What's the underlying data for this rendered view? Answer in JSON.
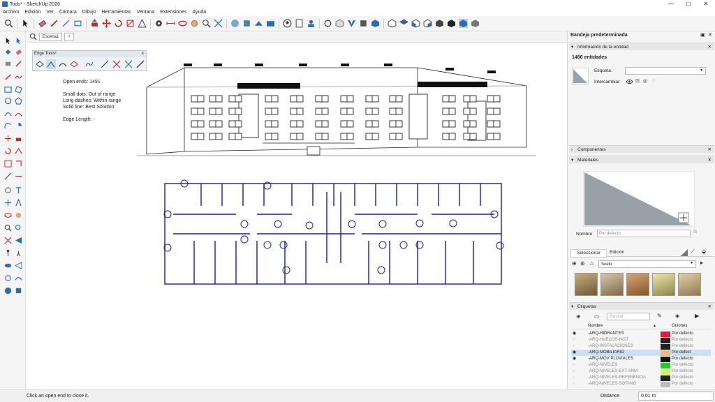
{
  "window": {
    "title": "Todo* - SketchUp 2026",
    "min": "—",
    "max": "▢",
    "close": "✕"
  },
  "menu": [
    "Archivo",
    "Edición",
    "Ver",
    "Cámara",
    "Dibujo",
    "Herramientas",
    "Ventana",
    "Extensiones",
    "Ayuda"
  ],
  "scene": {
    "tab": "Escena1",
    "add": "+"
  },
  "edge_tools": {
    "title": "Edge Tools²",
    "close": "x"
  },
  "overlay": {
    "open_ends": "Open ends: 1491",
    "line1": "Small dots: Out of range",
    "line2": "Long dashes: Within range",
    "line3": "Solid line: Best Solution",
    "edge_length": "Edge Length: -"
  },
  "status": {
    "hint": "Click an open end to close it.",
    "distance_label": "Distance",
    "distance_value": "0,01 m"
  },
  "tray": {
    "title": "Bandeja predeterminada"
  },
  "entity": {
    "section": "Información de la entidad",
    "count": "1486 entidades",
    "etiqueta_label": "Etiqueta:",
    "intercambiar_label": "Intercambiar:"
  },
  "components": {
    "section": "Componentes"
  },
  "materials": {
    "section": "Materiales",
    "nombre_label": "Nombre",
    "nombre_value": "Por defecto",
    "tab_select": "Seleccionar",
    "tab_edit": "Edición",
    "library": "Suelo"
  },
  "tags": {
    "section": "Etiquetas",
    "search_placeholder": "Buscar",
    "col_name": "Nombre",
    "col_dash": "Guiones",
    "rows": [
      {
        "name": "-ARQ-HIDRANTES",
        "dash": "Por defecto",
        "color": "#e8163a",
        "visible": true,
        "ghost": false,
        "selected": false
      },
      {
        "name": "-ARQ-HUECOS-INST",
        "dash": "Por defecto",
        "color": "#222222",
        "visible": false,
        "ghost": true,
        "selected": false
      },
      {
        "name": "-ARQ-INSTALACIONES",
        "dash": "Por defecto",
        "color": "#222222",
        "visible": false,
        "ghost": true,
        "selected": false
      },
      {
        "name": "-ARQ-MOBILIARIO",
        "dash": "Por defect",
        "color": "#f0b982",
        "visible": true,
        "ghost": false,
        "selected": true
      },
      {
        "name": "-ARQ-MOV PLUVIALES",
        "dash": "Por defecto",
        "color": "#111111",
        "visible": true,
        "ghost": false,
        "selected": false
      },
      {
        "name": "-ARQ-NIVELES",
        "dash": "Por defecto",
        "color": "#22cc22",
        "visible": false,
        "ghost": true,
        "selected": false
      },
      {
        "name": "-ARQ-NIVELES-EXT-SNM",
        "dash": "Por defecto",
        "color": "#d8f070",
        "visible": false,
        "ghost": true,
        "selected": false
      },
      {
        "name": "-ARQ-NIVELES-REFERENCIA",
        "dash": "Por defecto",
        "color": "#222222",
        "visible": false,
        "ghost": true,
        "selected": false
      },
      {
        "name": "-ARQ-NIVELES-SOTANO",
        "dash": "Por defecto",
        "color": "#bbbbbb",
        "visible": false,
        "ghost": true,
        "selected": false
      }
    ]
  }
}
